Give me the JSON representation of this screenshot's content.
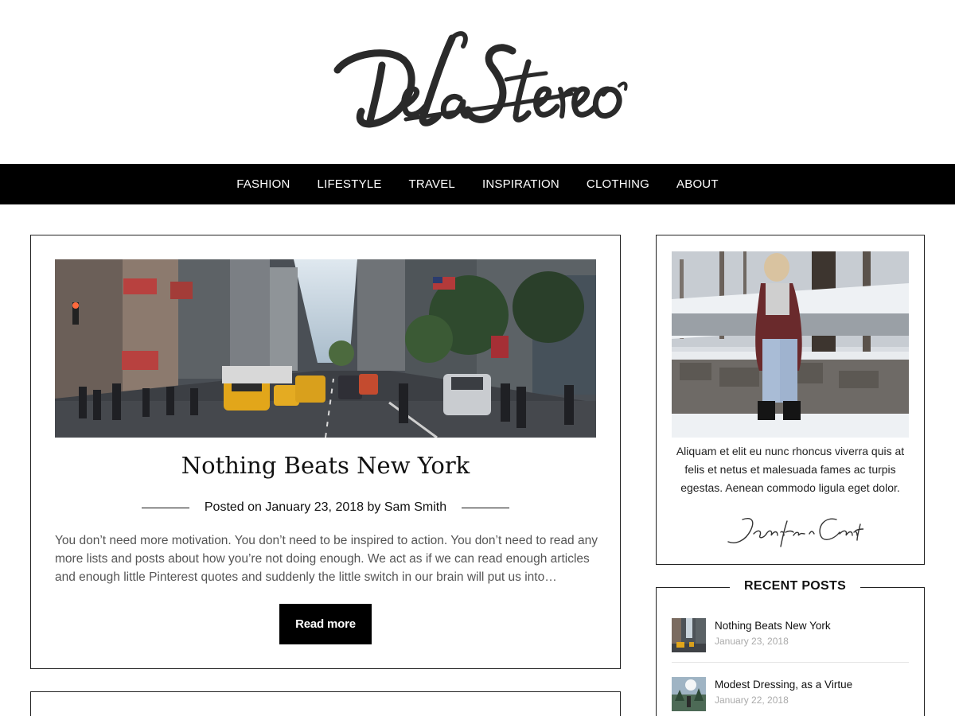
{
  "brand": {
    "logo_text": "DeLaStereo"
  },
  "nav": {
    "items": [
      "FASHION",
      "LIFESTYLE",
      "TRAVEL",
      "INSPIRATION",
      "CLOTHING",
      "ABOUT"
    ]
  },
  "post": {
    "title": "Nothing Beats New York",
    "meta_prefix": "Posted on",
    "date": "January 23, 2018",
    "meta_by": "by",
    "author": "Sam Smith",
    "excerpt": "You don’t need more motivation. You don’t need to be inspired to action. You don’t need to read any more lists and posts about how you’re not doing enough. We act as if we can read enough articles and enough little Pinterest quotes and suddenly the little switch in our brain will put us into…",
    "read_more": "Read more"
  },
  "about_widget": {
    "text": "Aliquam et elit eu nunc rhoncus viverra quis at felis et netus et malesuada fames ac turpis egestas. Aenean commodo ligula eget dolor.",
    "signature": "Jenifer Carter"
  },
  "recent_posts": {
    "title": "RECENT POSTS",
    "items": [
      {
        "title": "Nothing Beats New York",
        "date": "January 23, 2018"
      },
      {
        "title": "Modest Dressing, as a Virtue",
        "date": "January 22, 2018"
      }
    ]
  },
  "colors": {
    "nav_bg": "#000000",
    "text": "#111111",
    "excerpt": "#555555",
    "date_muted": "#aaaaaa"
  }
}
